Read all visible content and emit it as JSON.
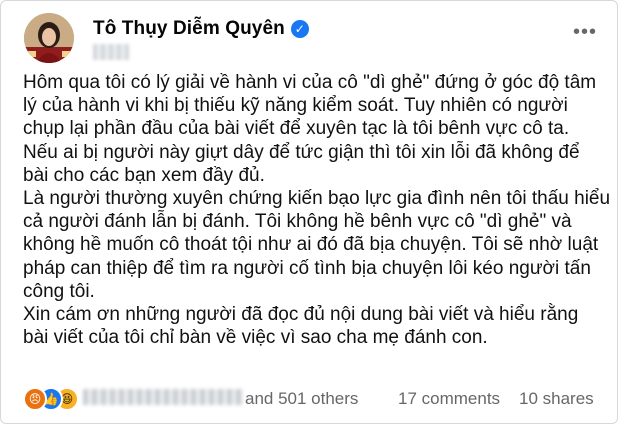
{
  "post": {
    "author": "Tô Thụy Diễm Quyên",
    "verified_icon": "verified-check-icon",
    "more_icon": "more-options-icon",
    "lines": [
      "Hôm qua tôi có lý giải về hành vi của cô \"dì ghẻ\" đứng ở góc độ tâm",
      "lý của hành vi khi bị thiếu kỹ năng kiểm soát. Tuy nhiên có người",
      "chụp lại phần đầu của bài viết để xuyên tạc là tôi bênh vực cô ta.",
      "Nếu ai bị người này giựt dây để tức giận thì tôi xin lỗi đã không để",
      "bài cho các bạn xem đầy đủ.",
      "Là người thường xuyên chứng kiến bạo lực gia đình nên tôi thấu hiểu",
      "cả người đánh lẫn bị đánh. Tôi không hề bênh vực cô \"dì ghẻ\" và",
      "không hề muốn cô thoát tội như ai đó đã bịa chuyện. Tôi sẽ nhờ luật",
      "pháp can thiệp để tìm ra người cố tình bịa chuyện lôi kéo người tấn",
      "công tôi.",
      "Xin cám ơn những người đã đọc đủ nội dung bài viết và hiểu rằng",
      "bài viết của tôi chỉ bàn về việc vì sao cha mẹ đánh con."
    ]
  },
  "footer": {
    "reaction_icons": [
      "angry-reaction-icon",
      "like-reaction-icon",
      "haha-reaction-icon"
    ],
    "others": "and 501 others",
    "comments": "17 comments",
    "shares": "10 shares"
  }
}
